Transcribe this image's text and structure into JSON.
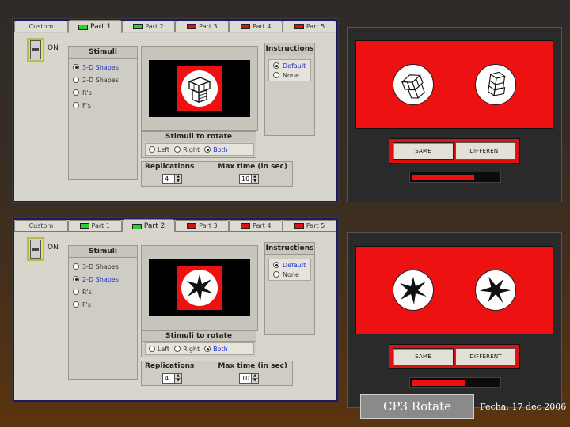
{
  "colors": {
    "accent_red": "#ee1111",
    "led_green": "#2bd12b",
    "selected_text": "#1a33cc",
    "panel": "#d8d5cc"
  },
  "panels": [
    {
      "tabs": [
        {
          "label": "Custom",
          "led": "none",
          "active": false
        },
        {
          "label": "Part 1",
          "led": "green",
          "active": true
        },
        {
          "label": "Part 2",
          "led": "green",
          "active": false
        },
        {
          "label": "Part 3",
          "led": "red",
          "active": false
        },
        {
          "label": "Part 4",
          "led": "red",
          "active": false
        },
        {
          "label": "Part 5",
          "led": "red",
          "active": false
        }
      ],
      "power_label": "ON",
      "stimuli": {
        "title": "Stimuli",
        "options": [
          "3-D Shapes",
          "2-D Shapes",
          "R's",
          "F's"
        ],
        "selected": 0
      },
      "preview_icon": "cube-stack-icon",
      "instructions": {
        "title": "Instructions",
        "options": [
          "Default",
          "None"
        ],
        "selected": 0
      },
      "rotate": {
        "title": "Stimuli to rotate",
        "options": [
          "Left",
          "Right",
          "Both"
        ],
        "selected": 2
      },
      "replications": {
        "label": "Replications",
        "value": "4"
      },
      "max_time": {
        "label": "Max time (in sec)",
        "value": "10"
      }
    },
    {
      "tabs": [
        {
          "label": "Custom",
          "led": "none",
          "active": false
        },
        {
          "label": "Part 1",
          "led": "green",
          "active": false
        },
        {
          "label": "Part 2",
          "led": "green",
          "active": true
        },
        {
          "label": "Part 3",
          "led": "red",
          "active": false
        },
        {
          "label": "Part 4",
          "led": "red",
          "active": false
        },
        {
          "label": "Part 5",
          "led": "red",
          "active": false
        }
      ],
      "power_label": "ON",
      "stimuli": {
        "title": "Stimuli",
        "options": [
          "3-D Shapes",
          "2-D Shapes",
          "R's",
          "F's"
        ],
        "selected": 1
      },
      "preview_icon": "star-shape-icon",
      "instructions": {
        "title": "Instructions",
        "options": [
          "Default",
          "None"
        ],
        "selected": 0
      },
      "rotate": {
        "title": "Stimuli to rotate",
        "options": [
          "Left",
          "Right",
          "Both"
        ],
        "selected": 2
      },
      "replications": {
        "label": "Replications",
        "value": "4"
      },
      "max_time": {
        "label": "Max time (in sec)",
        "value": "10"
      }
    }
  ],
  "screens": [
    {
      "left_icon": "cube-stack-icon",
      "right_icon": "cube-stack-icon",
      "same_label": "SAME",
      "different_label": "DIFFERENT",
      "progress": 0.72
    },
    {
      "left_icon": "star-shape-icon",
      "right_icon": "star-shape-icon",
      "same_label": "SAME",
      "different_label": "DIFFERENT",
      "progress": 0.62
    }
  ],
  "caption": "CP3 Rotate",
  "date": "Fecha: 17 dec 2006"
}
